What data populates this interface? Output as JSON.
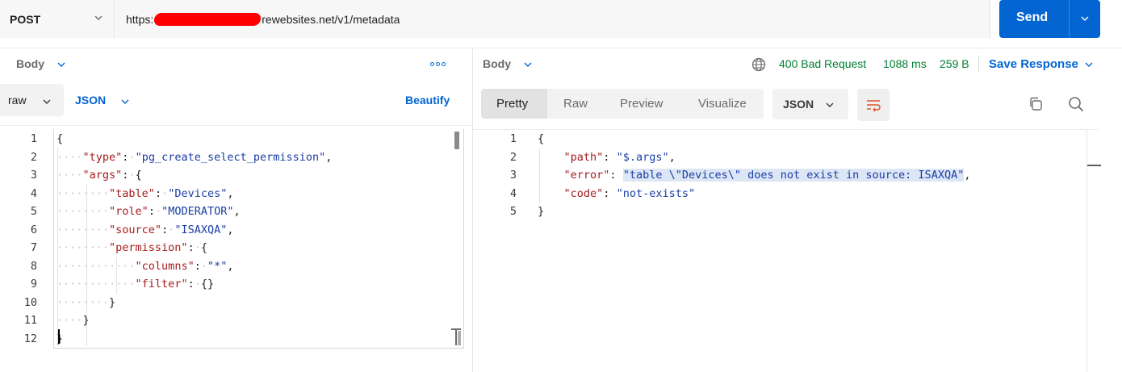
{
  "request": {
    "method": "POST",
    "url_prefix": "https:",
    "url_suffix": "rewebsites.net/v1/metadata",
    "send_label": "Send"
  },
  "request_body": {
    "tab_label": "Body",
    "body_mode": "raw",
    "language": "JSON",
    "beautify_label": "Beautify",
    "line_numbers": [
      "1",
      "2",
      "3",
      "4",
      "5",
      "6",
      "7",
      "8",
      "9",
      "10",
      "11",
      "12"
    ],
    "code": {
      "l1": "{",
      "l2_key": "\"type\"",
      "l2_val": "\"pg_create_select_permission\"",
      "l3_key": "\"args\"",
      "l4_key": "\"table\"",
      "l4_val": "\"Devices\"",
      "l5_key": "\"role\"",
      "l5_val": "\"MODERATOR\"",
      "l6_key": "\"source\"",
      "l6_val": "\"ISAXQA\"",
      "l7_key": "\"permission\"",
      "l8_key": "\"columns\"",
      "l8_val": "\"*\"",
      "l9_key": "\"filter\"",
      "l9_val": "{}",
      "l10": "}",
      "l11": "}",
      "l12": "}"
    }
  },
  "response": {
    "tab_label": "Body",
    "status": "400 Bad Request",
    "time": "1088 ms",
    "size": "259 B",
    "save_label": "Save Response",
    "view_tabs": [
      "Pretty",
      "Raw",
      "Preview",
      "Visualize"
    ],
    "active_view": "Pretty",
    "format": "JSON",
    "line_numbers": [
      "1",
      "2",
      "3",
      "4",
      "5"
    ],
    "code": {
      "l1": "{",
      "l2_key": "\"path\"",
      "l2_val": "\"$.args\"",
      "l3_key": "\"error\"",
      "l3_val": "\"table \\\"Devices\\\" does not exist in source: ISAXQA\"",
      "l4_key": "\"code\"",
      "l4_val": "\"not-exists\"",
      "l5": "}"
    }
  },
  "colors": {
    "accent": "#0265d2",
    "status_ok": "#007f31",
    "json_key": "#a61b1b",
    "json_string": "#1a3ea6",
    "redaction": "#ff0000"
  }
}
